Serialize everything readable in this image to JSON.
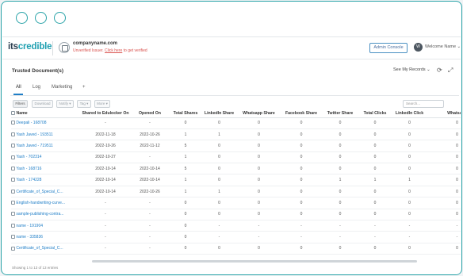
{
  "browser": {
    "dots": 3
  },
  "header": {
    "logo_part1": "its",
    "logo_part2": "credible",
    "company_name": "companyname.com",
    "unverified_text": "Unverified Issuer.",
    "click_here": "Click here",
    "verify_text": "to get verified",
    "admin_button": "Admin Console",
    "avatar_initial": "W",
    "welcome": "Welcome Name ⌄"
  },
  "panel": {
    "title": "Trusted Document(s)",
    "records_select": "See My Records ⌄",
    "tabs": [
      "All",
      "Log",
      "Marketing",
      "+"
    ],
    "toolbar": {
      "filters": "Filters",
      "download": "Download",
      "notify": "Notify ▾",
      "tag": "Tag ▾",
      "more": "More ▾",
      "search_placeholder": "Search..."
    },
    "columns": [
      "Name",
      "Shared to Edulocker On",
      "Opened On",
      "Total Shares",
      "LinkedIn Share",
      "Whatsapp Share",
      "Facebook Share",
      "Twitter Share",
      "Total Clicks",
      "LinkedIn Click",
      "Whatsapp"
    ],
    "rows": [
      [
        "Deepali - 168708",
        "-",
        "-",
        "0",
        "0",
        "0",
        "0",
        "0",
        "0",
        "0",
        "0"
      ],
      [
        "Yash Javed - 193511",
        "2022-11-18",
        "2022-10-26",
        "1",
        "1",
        "0",
        "0",
        "0",
        "0",
        "0",
        "0"
      ],
      [
        "Yash Javed - 719511",
        "2022-10-26",
        "2022-11-12",
        "5",
        "0",
        "0",
        "0",
        "0",
        "0",
        "0",
        "0"
      ],
      [
        "Yash - 702314",
        "2022-10-27",
        "-",
        "1",
        "0",
        "0",
        "0",
        "0",
        "0",
        "0",
        "0"
      ],
      [
        "Yash - 168716",
        "2022-10-14",
        "2022-10-14",
        "5",
        "0",
        "0",
        "0",
        "0",
        "0",
        "0",
        "0"
      ],
      [
        "Yash - 174228",
        "2022-10-14",
        "2022-10-14",
        "1",
        "0",
        "0",
        "0",
        "1",
        "1",
        "1",
        "0"
      ],
      [
        "Certificate_of_Special_C...",
        "2022-10-14",
        "2022-10-26",
        "1",
        "1",
        "0",
        "0",
        "0",
        "0",
        "0",
        "0"
      ],
      [
        "English-handwriting-curve...",
        "-",
        "-",
        "0",
        "0",
        "0",
        "0",
        "0",
        "0",
        "0",
        "0"
      ],
      [
        "sample-publishing-contra...",
        "-",
        "-",
        "0",
        "0",
        "0",
        "0",
        "0",
        "0",
        "0",
        "0"
      ],
      [
        "name - 191904",
        "-",
        "-",
        "0",
        "-",
        "-",
        "-",
        "-",
        "-",
        "-",
        "-"
      ],
      [
        "name - 335836",
        "-",
        "-",
        "0",
        "-",
        "-",
        "-",
        "-",
        "-",
        "-",
        "-"
      ],
      [
        "Certificate_of_Special_C...",
        "-",
        "-",
        "0",
        "0",
        "0",
        "0",
        "0",
        "0",
        "0",
        "0"
      ]
    ],
    "footer": "Showing 1 to 13 of 13 entries"
  },
  "colors": {
    "accent": "#2aa3a8",
    "link": "#1f7ec7",
    "warning": "#d9534f"
  }
}
